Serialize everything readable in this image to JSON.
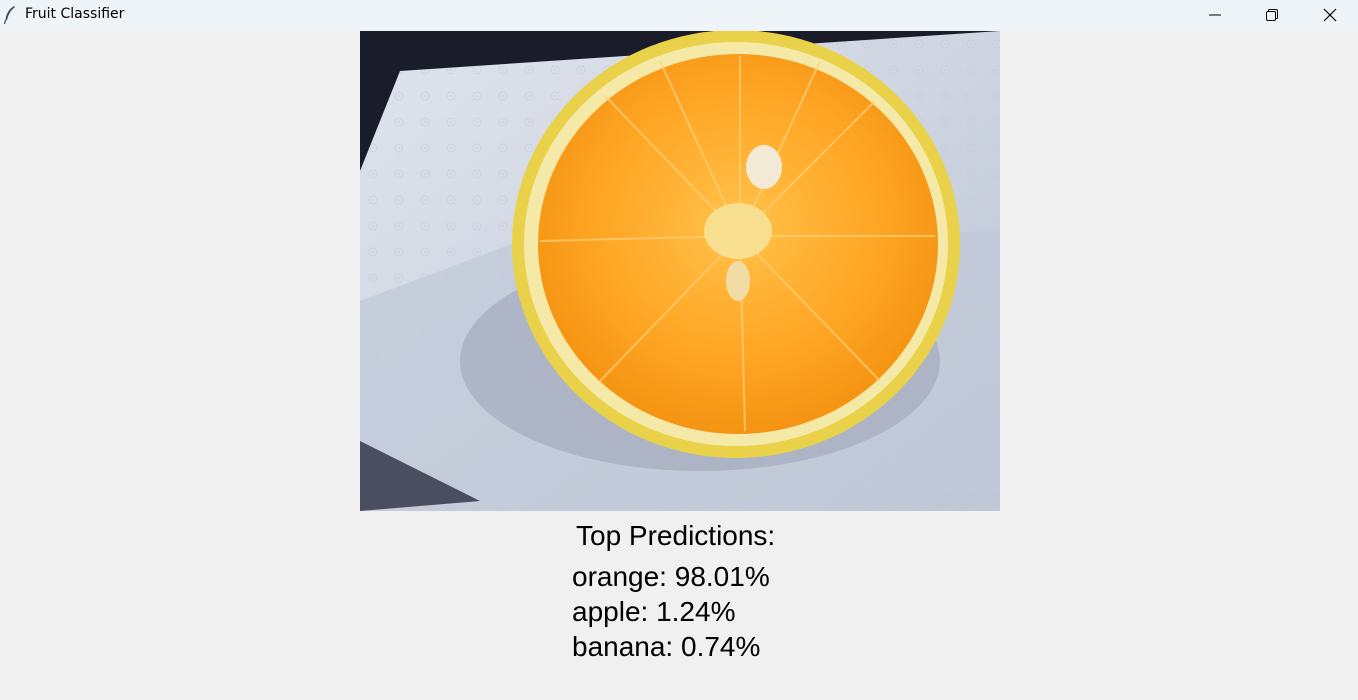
{
  "window": {
    "title": "Fruit Classifier",
    "icon": "feather-icon",
    "controls": [
      "minimize-icon",
      "restore-icon",
      "close-icon"
    ]
  },
  "image": {
    "subject": "orange slice on paper towel"
  },
  "results": {
    "heading": "Top Predictions:",
    "predictions": [
      {
        "text": "orange: 98.01%",
        "label": "orange",
        "probability": 98.01
      },
      {
        "text": "apple: 1.24%",
        "label": "apple",
        "probability": 1.24
      },
      {
        "text": "banana: 0.74%",
        "label": "banana",
        "probability": 0.74
      }
    ]
  },
  "colors": {
    "titlebar": "#eff4f9",
    "background": "#f0f0f0",
    "text": "#000000"
  }
}
